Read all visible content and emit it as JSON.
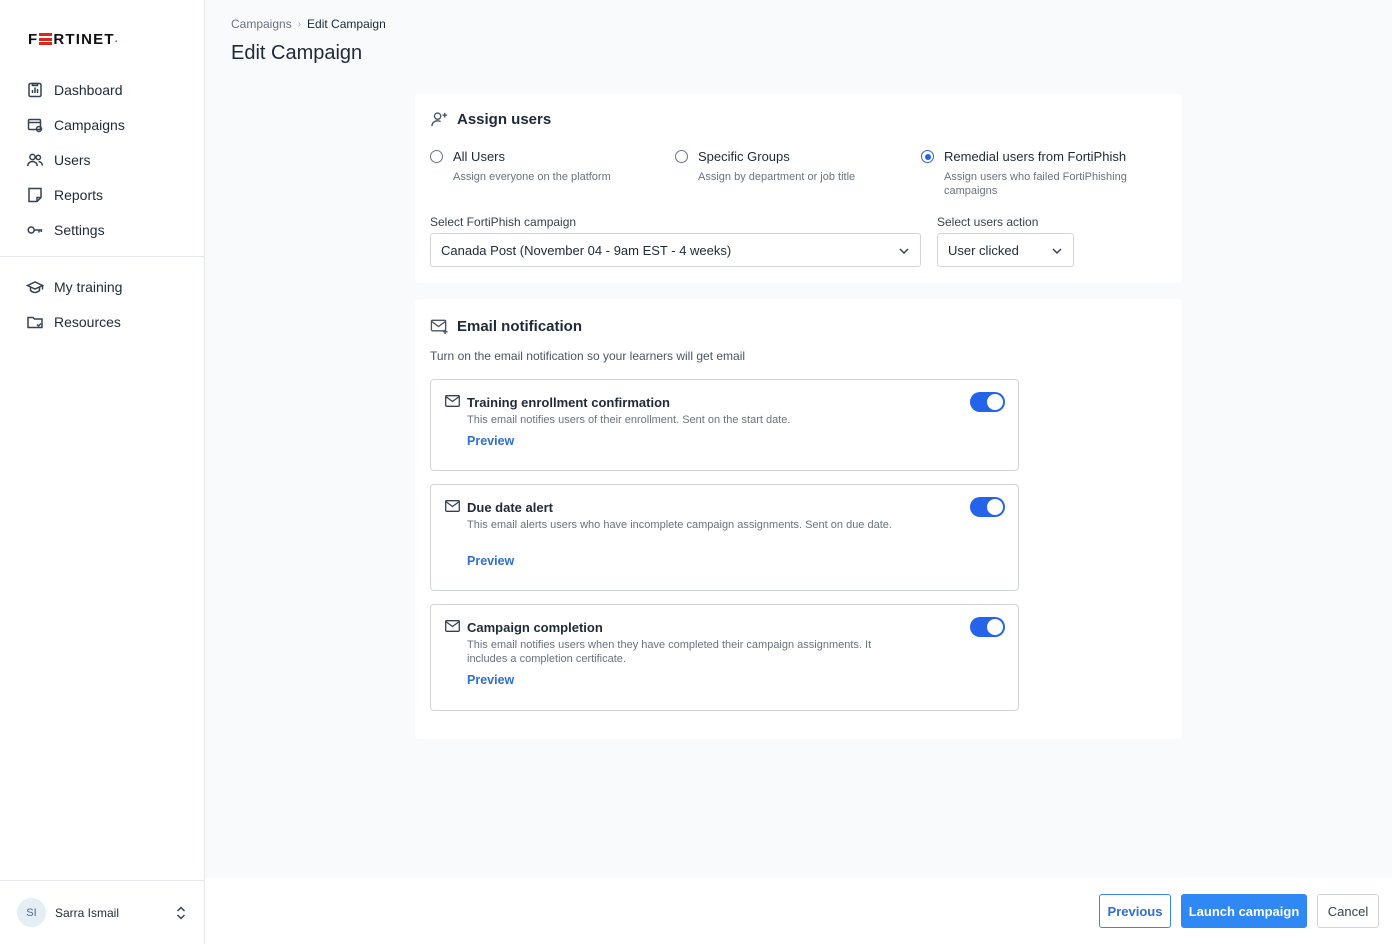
{
  "brand": {
    "logo_text_a": "F",
    "logo_text_b": "RTINET",
    "logo_mark": "."
  },
  "sidebar": {
    "items": [
      {
        "label": "Dashboard",
        "icon": "dashboard-icon"
      },
      {
        "label": "Campaigns",
        "icon": "campaigns-icon"
      },
      {
        "label": "Users",
        "icon": "users-icon"
      },
      {
        "label": "Reports",
        "icon": "reports-icon"
      },
      {
        "label": "Settings",
        "icon": "settings-icon"
      }
    ],
    "secondary_items": [
      {
        "label": "My training",
        "icon": "graduation-cap-icon"
      },
      {
        "label": "Resources",
        "icon": "folder-icon"
      }
    ],
    "user": {
      "initials": "SI",
      "name": "Sarra Ismail"
    }
  },
  "header": {
    "breadcrumb": {
      "parent": "Campaigns",
      "sep": "›",
      "current": "Edit Campaign"
    },
    "title": "Edit Campaign"
  },
  "assign_users": {
    "title": "Assign users",
    "options": [
      {
        "label": "All Users",
        "desc": "Assign everyone on the platform",
        "checked": false
      },
      {
        "label": "Specific Groups",
        "desc": "Assign by department or job title",
        "checked": false
      },
      {
        "label": "Remedial users from FortiPhish",
        "desc": "Assign users who failed FortiPhishing campaigns",
        "checked": true
      }
    ],
    "campaign_label": "Select FortiPhish campaign",
    "campaign_value": "Canada Post (November 04 - 9am EST - 4 weeks)",
    "action_label": "Select users action",
    "action_value": "User clicked"
  },
  "email_notification": {
    "title": "Email notification",
    "intro": "Turn on the email notification so your learners will get email",
    "items": [
      {
        "title": "Training enrollment confirmation",
        "desc": "This email notifies users of their enrollment. Sent on the start date.",
        "preview": "Preview",
        "enabled": true
      },
      {
        "title": "Due date alert",
        "desc": "This email alerts users who have incomplete campaign assignments. Sent on due date.",
        "preview": "Preview",
        "enabled": true
      },
      {
        "title": "Campaign completion",
        "desc": "This email notifies users when they have completed their campaign assignments. It includes a completion certificate.",
        "preview": "Preview",
        "enabled": true
      }
    ]
  },
  "footer": {
    "previous": "Previous",
    "launch": "Launch campaign",
    "cancel": "Cancel"
  },
  "colors": {
    "accent": "#2563eb",
    "brand_red": "#da291c",
    "link": "#2f6fd1"
  }
}
